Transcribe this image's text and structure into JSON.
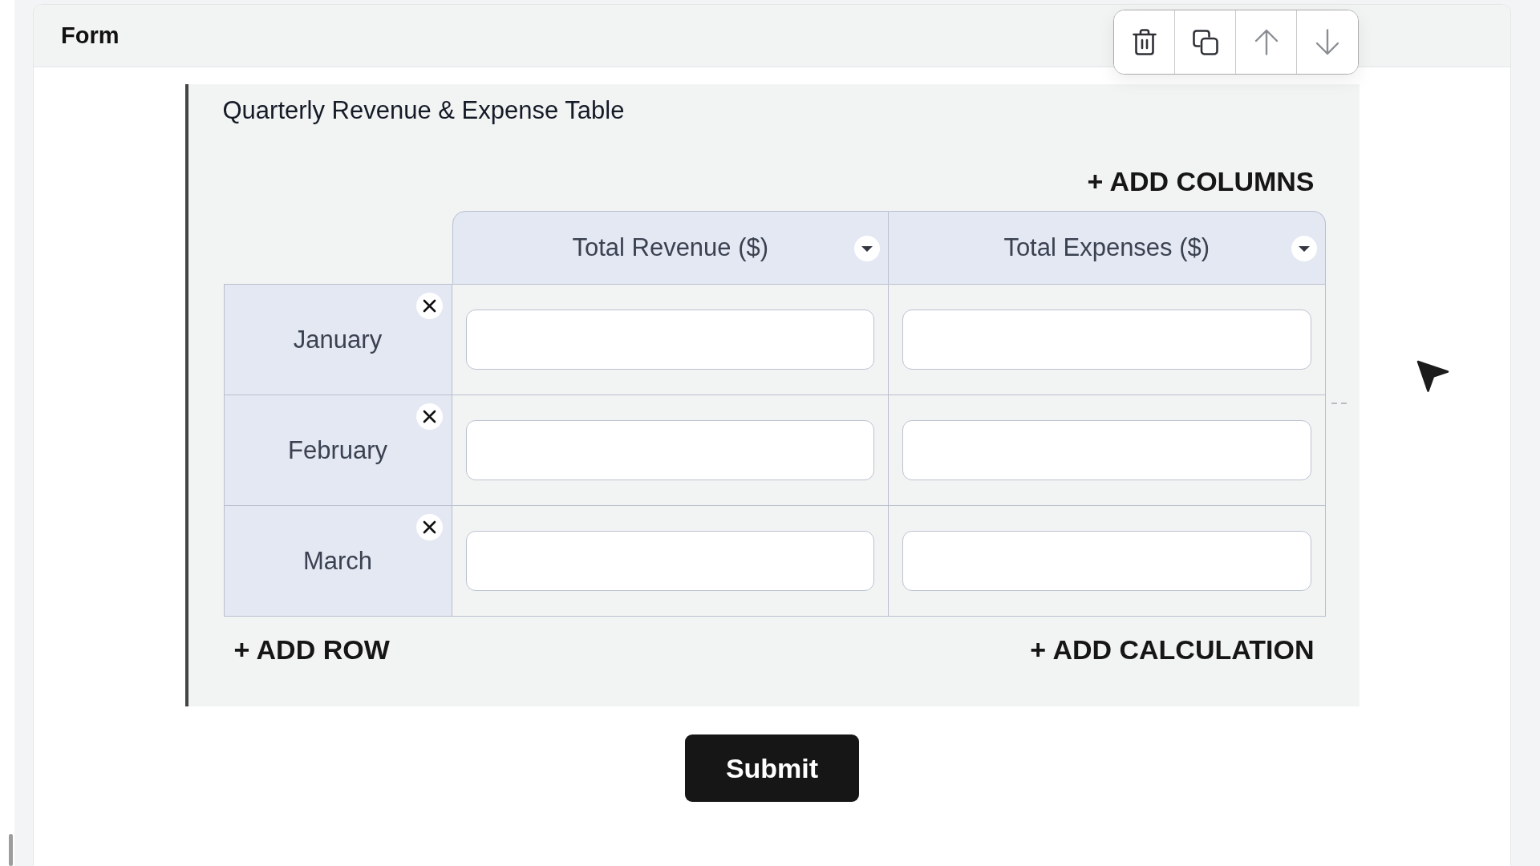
{
  "form": {
    "title": "Form"
  },
  "toolbar": [
    {
      "kind": "delete",
      "disabled": false
    },
    {
      "kind": "duplicate",
      "disabled": false
    },
    {
      "kind": "move_up",
      "disabled": true
    },
    {
      "kind": "move_down",
      "disabled": true
    }
  ],
  "table_block": {
    "title": "Quarterly Revenue & Expense Table",
    "add_columns": "+ ADD COLUMNS",
    "columns": [
      {
        "label": "Total Revenue ($)"
      },
      {
        "label": "Total Expenses ($)"
      }
    ],
    "rows": [
      {
        "label": "January"
      },
      {
        "label": "February"
      },
      {
        "label": "March"
      }
    ],
    "add_row": "+ ADD ROW",
    "add_calculation": "+ ADD CALCULATION"
  },
  "submit": "Submit"
}
